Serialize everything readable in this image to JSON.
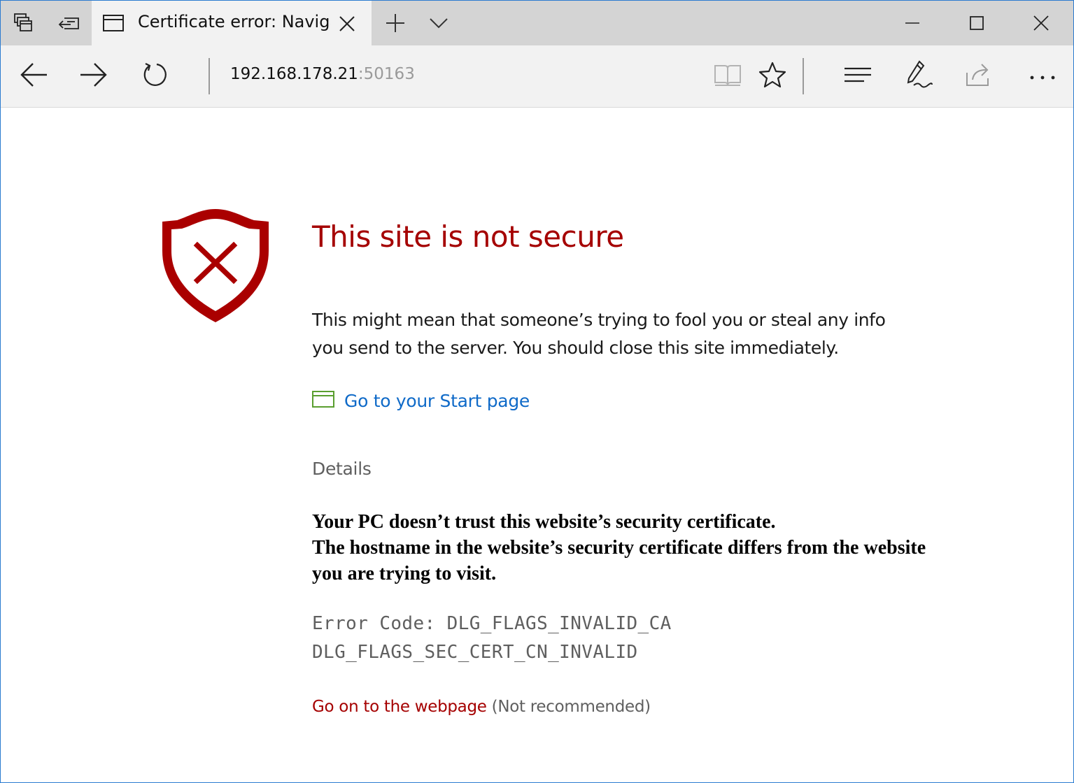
{
  "window": {
    "tab": {
      "title": "Certificate error: Naviga"
    }
  },
  "navbar": {
    "address": {
      "host": "192.168.178.21",
      "port": ":50163"
    }
  },
  "page": {
    "heading": "This site is not secure",
    "message_lines": [
      "This might mean that someone’s trying to fool you or steal any info",
      "you send to the server. You should close this site immediately."
    ],
    "start_link": "Go to your Start page",
    "details_label": "Details",
    "cert_info_lines": [
      "Your PC doesn’t trust this website’s security certificate.",
      "The hostname in the website’s security certificate differs from the website you are trying to visit."
    ],
    "error_code_lines": [
      "Error Code: DLG_FLAGS_INVALID_CA",
      "DLG_FLAGS_SEC_CERT_CN_INVALID"
    ],
    "proceed_link": "Go on to the webpage",
    "proceed_note": "(Not recommended)"
  },
  "colors": {
    "heading": "#a50000",
    "link": "#0f6ac8",
    "start_icon": "#5a9e2f",
    "window_border": "#2b7bd0"
  },
  "icons": [
    "tabs-aside-icon",
    "set-tabs-aside-icon",
    "tab-page-icon",
    "close-tab-icon",
    "new-tab-icon",
    "tab-preview-chevron-icon",
    "minimize-icon",
    "maximize-icon",
    "close-window-icon",
    "back-arrow-icon",
    "forward-arrow-icon",
    "refresh-icon",
    "reading-view-icon",
    "favorite-star-icon",
    "hub-icon",
    "web-note-icon",
    "share-icon",
    "more-icon",
    "shield-error-icon",
    "start-page-icon"
  ]
}
